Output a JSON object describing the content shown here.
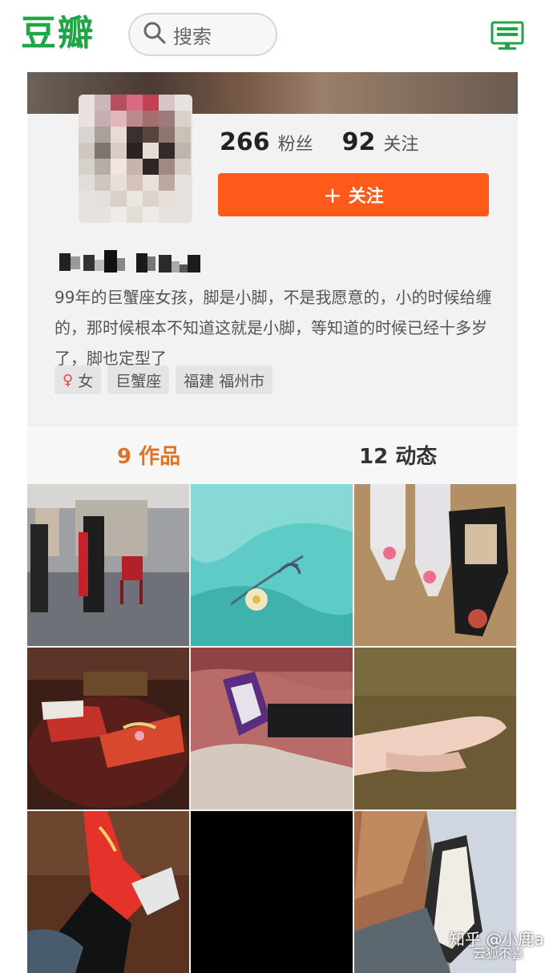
{
  "app": {
    "logo_text": "豆瓣",
    "brand_color": "#1fa646",
    "search_placeholder": "搜索"
  },
  "profile": {
    "followers_count": "266",
    "followers_label": "粉丝",
    "following_count": "92",
    "following_label": "关注",
    "follow_button_icon": "+",
    "follow_button_label": "关注",
    "follow_button_color": "#ff5a1a",
    "bio": "99年的巨蟹座女孩，脚是小脚，不是我愿意的，小的时候给缠的，那时候根本不知道这就是小脚，等知道的时候已经十多岁了，脚也定型了",
    "tags": [
      {
        "icon": "female-icon",
        "glyph": "♀",
        "label": "女"
      },
      {
        "label": "巨蟹座"
      },
      {
        "label": "福建 福州市"
      }
    ]
  },
  "tabs": [
    {
      "label": "9 作品",
      "active": true,
      "color": "#e0731f"
    },
    {
      "label": "12 动态",
      "active": false
    }
  ],
  "grid": {
    "photo_count": 9
  },
  "watermark": {
    "line1": "知乎 @小鹿a",
    "line2": "云狐不喜"
  }
}
